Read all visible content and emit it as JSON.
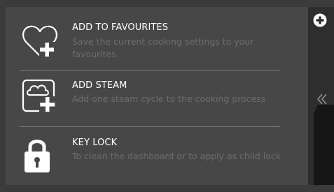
{
  "menu": {
    "items": [
      {
        "icon": "heart-plus-icon",
        "title": "ADD TO FAVOURITES",
        "description": "Save the current cooking settings to your favourites"
      },
      {
        "icon": "steam-plus-icon",
        "title": "ADD STEAM",
        "description": "Add one steam cycle to the cooking process"
      },
      {
        "icon": "padlock-icon",
        "title": "KEY LOCK",
        "description": "To clean the dashboard or to apply as child lock"
      }
    ]
  },
  "sidebar": {
    "top_icon": "plus-circle-icon",
    "collapse_icon": "double-chevron-left-icon"
  },
  "colors": {
    "background": "#3b3b3b",
    "panel": "#474747",
    "title_text": "#ffffff",
    "description_text": "#6d6d6d",
    "divider": "#7a7a7a",
    "tab": "#161616"
  }
}
